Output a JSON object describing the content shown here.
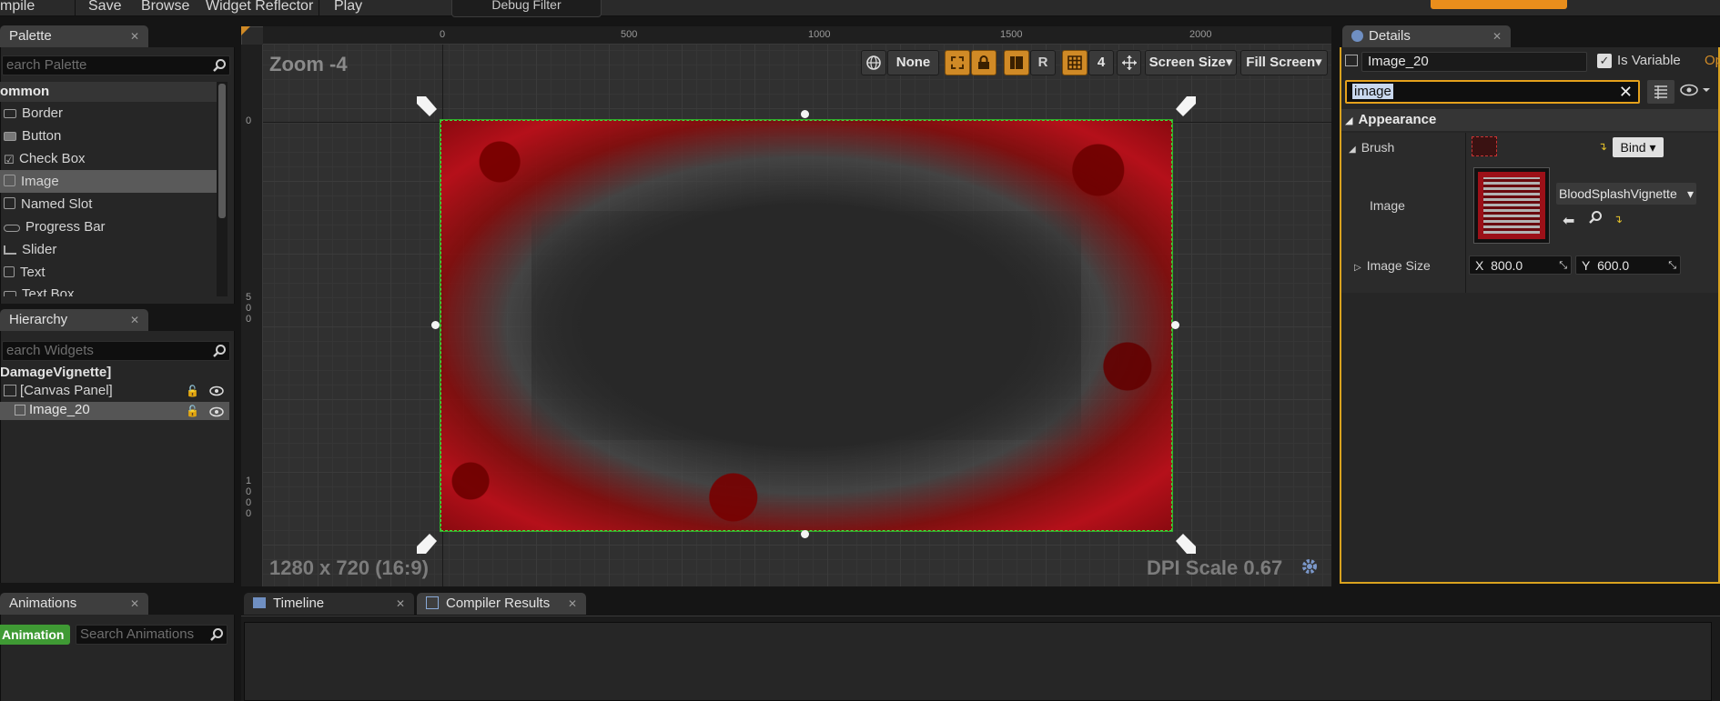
{
  "toolbar": {
    "compile": "mpile",
    "save": "Save",
    "browse": "Browse",
    "widget_reflector": "Widget Reflector",
    "play": "Play",
    "debug_filter": "Debug Filter"
  },
  "palette": {
    "tab": "Palette",
    "search_placeholder": "earch Palette",
    "category": "ommon",
    "items": [
      {
        "label": "Border",
        "icon": "border-icon"
      },
      {
        "label": "Button",
        "icon": "button-icon"
      },
      {
        "label": "Check Box",
        "icon": "checkbox-icon"
      },
      {
        "label": "Image",
        "icon": "image-icon"
      },
      {
        "label": "Named Slot",
        "icon": "named-slot-icon"
      },
      {
        "label": "Progress Bar",
        "icon": "progress-bar-icon"
      },
      {
        "label": "Slider",
        "icon": "slider-icon"
      },
      {
        "label": "Text",
        "icon": "text-icon"
      },
      {
        "label": "Text Box",
        "icon": "text-box-icon"
      }
    ],
    "selected": "Image"
  },
  "hierarchy": {
    "tab": "Hierarchy",
    "search_placeholder": "earch Widgets",
    "root": "DamageVignette]",
    "canvas_panel": "[Canvas Panel]",
    "child": "Image_20"
  },
  "animations": {
    "tab": "Animations",
    "add_button": "Animation",
    "search_placeholder": "Search Animations"
  },
  "bottom_tabs": {
    "timeline": "Timeline",
    "compiler_results": "Compiler Results"
  },
  "designer": {
    "zoom": "Zoom -4",
    "resolution": "1280 x 720 (16:9)",
    "dpi": "DPI Scale 0.67",
    "none": "None",
    "r_label": "R",
    "grid_value": "4",
    "screen_size": "Screen Size",
    "fill_screen": "Fill Screen",
    "ruler_top": [
      "0",
      "500",
      "1000",
      "1500",
      "2000"
    ],
    "ruler_left": [
      {
        "d": [
          "0"
        ]
      },
      {
        "d": [
          "5",
          "0",
          "0"
        ]
      },
      {
        "d": [
          "1",
          "0",
          "0",
          "0"
        ]
      }
    ]
  },
  "details": {
    "tab": "Details",
    "name_value": "Image_20",
    "is_variable": "Is Variable",
    "op": "Op",
    "search_value": "image",
    "section": "Appearance",
    "brush": "Brush",
    "bind": "Bind",
    "image_label": "Image",
    "image_asset": "BloodSplashVignette",
    "image_size": "Image Size",
    "size_x_label": "X",
    "size_x": "800.0",
    "size_y_label": "Y",
    "size_y": "600.0"
  },
  "colors": {
    "accent_orange": "#d08a26",
    "selection_green": "#46d640",
    "blood_red": "#b5101a",
    "panel_bg": "#262626"
  }
}
